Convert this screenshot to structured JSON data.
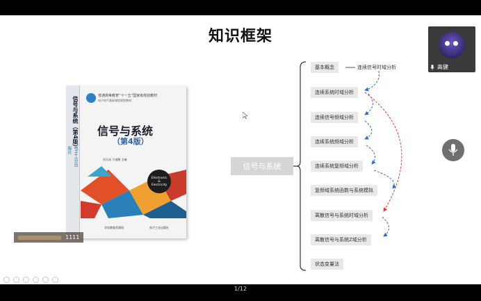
{
  "slide": {
    "title": "知识框架",
    "page_indicator": "1/12"
  },
  "book": {
    "series_line1": "普通高等教育“十一五”国家级规划教材",
    "series_line2": "电子电气基础课程规划教材",
    "title": "信号与系统",
    "edition": "（第4版）",
    "authors": "徐天成  于维鹏  主编",
    "spine_title": "信号与系统（第4版）",
    "spine_badge": "电子工业出版社",
    "art_text1": "Electronic",
    "art_text2": "&",
    "art_text3": "Electricity",
    "publisher_left": "华信教育资源网",
    "publisher_right": "电子工业出版社"
  },
  "caption": {
    "text": "1111"
  },
  "mindmap": {
    "center": "信号与系统",
    "nodes": [
      "基本概念",
      "连续系统时域分析",
      "连续信号频域分析",
      "连续系统频域分析",
      "连续系统复频域分析",
      "复频域系统函数与系统模拟",
      "离散信号与系统时域分析",
      "离散信号与系统Z域分析",
      "状态变量法"
    ],
    "aside_label": "连续信号时域分析",
    "colors": {
      "node_bg": "#e9e9e9",
      "center_bg": "#d6d6d6",
      "blue_arrow": "#2d6fd0",
      "red_arrow": "#e03b3b"
    }
  },
  "video": {
    "name": "高健",
    "icons": [
      "mic-icon",
      "avatar"
    ]
  },
  "controls": {
    "mic_button_icon": "microphone-icon"
  }
}
